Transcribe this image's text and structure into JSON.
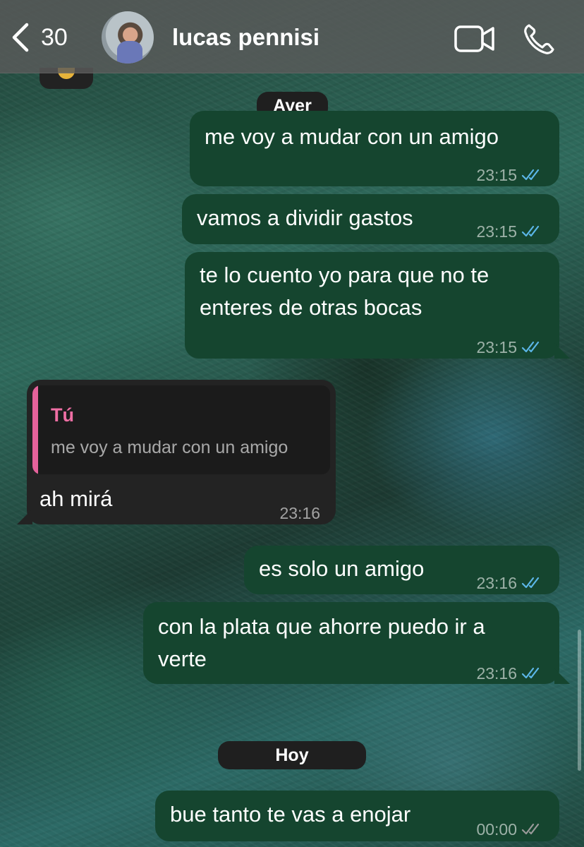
{
  "header": {
    "back_count": "30",
    "contact_name": "lucas pennisi",
    "icons": [
      "chevron-left-icon",
      "video-call-icon",
      "phone-icon"
    ]
  },
  "dates": {
    "ayer": "Ayer",
    "hoy": "Hoy"
  },
  "messages": [
    {
      "direction": "out",
      "text": "me voy a mudar con un amigo",
      "time": "23:15",
      "status": "read"
    },
    {
      "direction": "out",
      "text": "vamos a dividir gastos",
      "time": "23:15",
      "status": "read"
    },
    {
      "direction": "out",
      "lines": [
        "te lo cuento yo para que no te",
        "enteres de otras bocas"
      ],
      "time": "23:15",
      "status": "read"
    },
    {
      "direction": "in",
      "quote_author": "Tú",
      "quote_text": "me voy a mudar con un amigo",
      "text": "ah mirá",
      "time": "23:16"
    },
    {
      "direction": "out",
      "text": "es solo un amigo",
      "time": "23:16",
      "status": "read"
    },
    {
      "direction": "out",
      "lines": [
        "con la plata que ahorre puedo ir a",
        "verte"
      ],
      "time": "23:16",
      "status": "read"
    },
    {
      "direction": "out",
      "text": "bue tanto te vas a enojar",
      "time": "00:00",
      "status": "delivered"
    }
  ],
  "colors": {
    "outgoing_bubble": "#15452f",
    "incoming_bubble": "#232323",
    "read_ticks": "#5bb6e8",
    "delivered_ticks": "#9a9a9a",
    "quote_accent": "#e5629b"
  }
}
